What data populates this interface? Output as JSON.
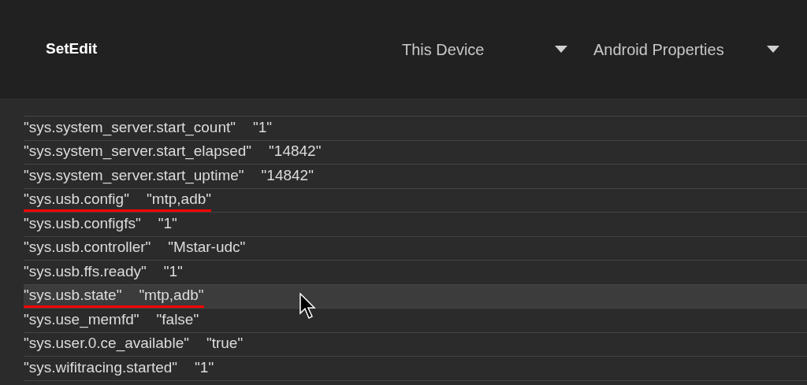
{
  "app_title": "SetEdit",
  "dropdowns": [
    {
      "label": "This Device"
    },
    {
      "label": "Android Properties"
    }
  ],
  "rows": [
    {
      "key": "\"sys.system_server.start_count\"",
      "value": "\"1\"",
      "selected": false,
      "underlined": false
    },
    {
      "key": "\"sys.system_server.start_elapsed\"",
      "value": "\"14842\"",
      "selected": false,
      "underlined": false
    },
    {
      "key": "\"sys.system_server.start_uptime\"",
      "value": "\"14842\"",
      "selected": false,
      "underlined": false
    },
    {
      "key": "\"sys.usb.config\"",
      "value": "\"mtp,adb\"",
      "selected": false,
      "underlined": true
    },
    {
      "key": "\"sys.usb.configfs\"",
      "value": "\"1\"",
      "selected": false,
      "underlined": false
    },
    {
      "key": "\"sys.usb.controller\"",
      "value": "\"Mstar-udc\"",
      "selected": false,
      "underlined": false
    },
    {
      "key": "\"sys.usb.ffs.ready\"",
      "value": "\"1\"",
      "selected": false,
      "underlined": false
    },
    {
      "key": "\"sys.usb.state\"",
      "value": "\"mtp,adb\"",
      "selected": true,
      "underlined": true
    },
    {
      "key": "\"sys.use_memfd\"",
      "value": "\"false\"",
      "selected": false,
      "underlined": false
    },
    {
      "key": "\"sys.user.0.ce_available\"",
      "value": "\"true\"",
      "selected": false,
      "underlined": false
    },
    {
      "key": "\"sys.wifitracing.started\"",
      "value": "\"1\"",
      "selected": false,
      "underlined": false
    }
  ]
}
